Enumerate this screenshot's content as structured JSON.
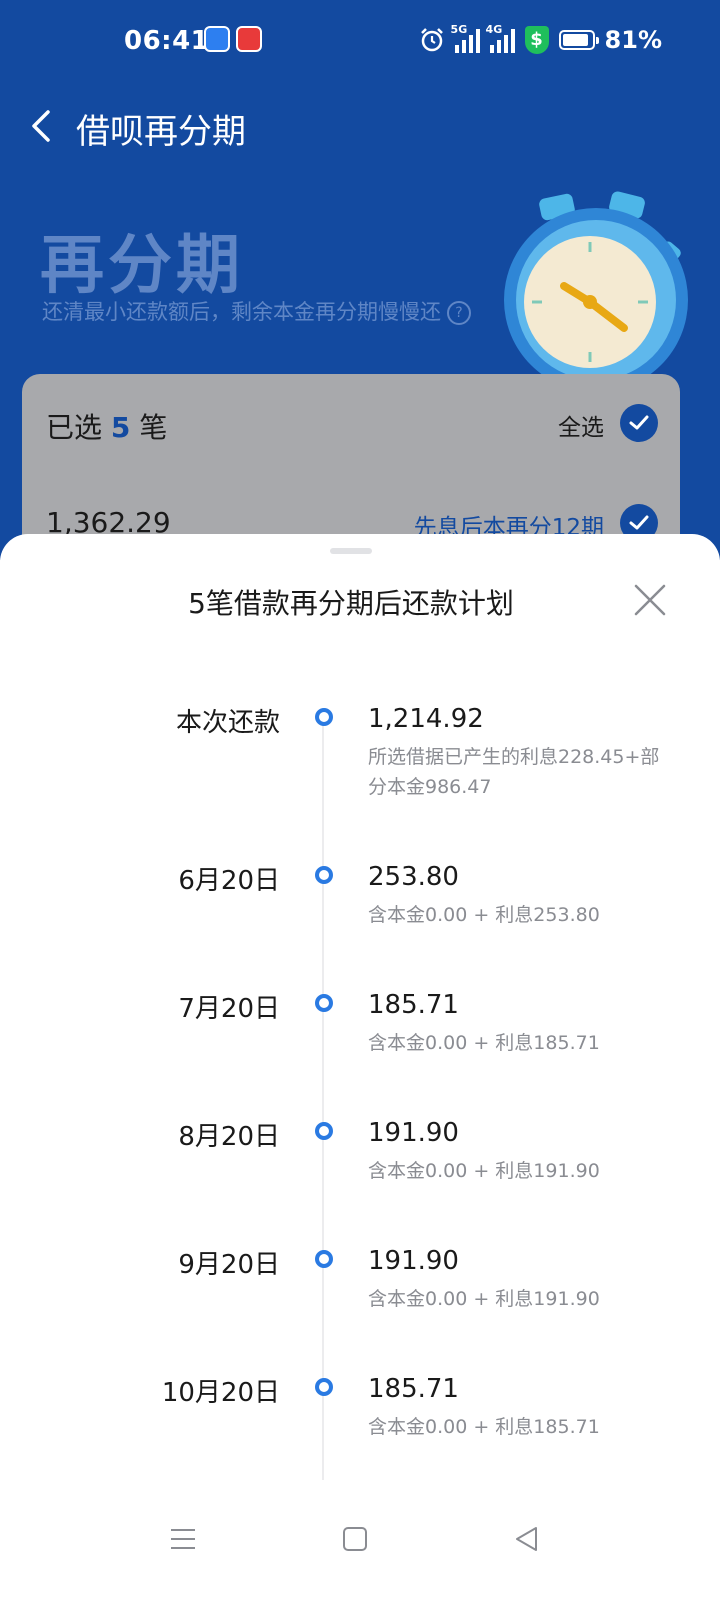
{
  "status_bar": {
    "time": "06:41",
    "network_1": "5G",
    "network_2": "4G",
    "battery": "81%"
  },
  "header": {
    "title": "借呗再分期"
  },
  "hero": {
    "title": "再分期",
    "subtitle": "还清最小还款额后，剩余本金再分期慢慢还"
  },
  "card": {
    "selected_prefix": "已选",
    "selected_count": "5",
    "selected_suffix": "笔",
    "select_all": "全选",
    "loan_amount": "1,362.29",
    "loan_plan": "先息后本再分12期"
  },
  "sheet": {
    "title": "5笔借款再分期后还款计划",
    "rows": [
      {
        "date": "本次还款",
        "amount": "1,214.92",
        "desc": "所选借据已产生的利息228.45+部分本金986.47"
      },
      {
        "date": "6月20日",
        "amount": "253.80",
        "desc": "含本金0.00 + 利息253.80"
      },
      {
        "date": "7月20日",
        "amount": "185.71",
        "desc": "含本金0.00 + 利息185.71"
      },
      {
        "date": "8月20日",
        "amount": "191.90",
        "desc": "含本金0.00 + 利息191.90"
      },
      {
        "date": "9月20日",
        "amount": "191.90",
        "desc": "含本金0.00 + 利息191.90"
      },
      {
        "date": "10月20日",
        "amount": "185.71",
        "desc": "含本金0.00 + 利息185.71"
      }
    ]
  },
  "colors": {
    "brand_blue": "#134aa0",
    "timeline_dot": "#2a7ae2",
    "muted_text": "#8a8c92"
  },
  "icons": [
    "back-arrow-icon",
    "help-icon",
    "stopwatch-icon",
    "check-circle-icon",
    "close-icon",
    "menu-icon",
    "home-square-icon",
    "back-triangle-icon"
  ]
}
